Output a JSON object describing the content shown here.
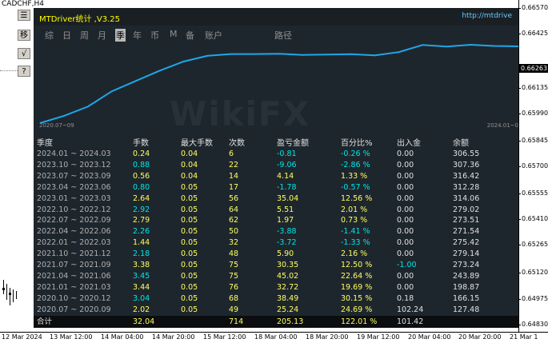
{
  "symbol": "CADCHF,H4",
  "price_axis": {
    "current": "0.66263",
    "ticks": [
      "0.66570",
      "0.66425",
      "0.66135",
      "0.65990",
      "0.65845",
      "0.65700",
      "0.65555",
      "0.65410",
      "0.65265",
      "0.65120",
      "0.64975",
      "0.64830"
    ]
  },
  "time_axis": [
    "12 Mar 2024",
    "13 Mar 12:00",
    "14 Mar 04:00",
    "14 Mar 20:00",
    "15 Mar 12:00",
    "18 Mar 04:00",
    "18 Mar 20:00",
    "19 Mar 12:00",
    "20 Mar 04:00",
    "20 Mar 20:00",
    "21 Mar 1"
  ],
  "tools": [
    "☰",
    "移",
    "√",
    "?"
  ],
  "panel": {
    "title": "MTDriver统计 ,V3.25",
    "url": "http://mtdrive",
    "tabs": [
      "综",
      "日",
      "周",
      "月",
      "季",
      "年",
      "币",
      "M",
      "备",
      "账户",
      "路径"
    ],
    "active_tab": "季",
    "curve_start_label": "2020.07~09",
    "curve_end_label": "2024.01~0",
    "curve_values": [
      0.0,
      4.14,
      9.4,
      18.2,
      24.1,
      30.0,
      35.2,
      38.5,
      39.5,
      39.5,
      39.7,
      39.0,
      39.2,
      39.4,
      38.7,
      40.6,
      44.7,
      43.8,
      44.8,
      44.1,
      43.9
    ],
    "curve_color": "#1ea7e8",
    "headers": [
      "季度",
      "手数",
      "最大手数",
      "次数",
      "盈亏金额",
      "百分比%",
      "出入金",
      "余额"
    ],
    "rows": [
      [
        "2024.01 ~ 2024.03",
        "0.24",
        "0.04",
        "6",
        "-0.81",
        "-0.26 %",
        "0.00",
        "306.55"
      ],
      [
        "2023.10 ~ 2023.12",
        "0.88",
        "0.04",
        "22",
        "-9.06",
        "-2.86 %",
        "0.00",
        "307.36"
      ],
      [
        "2023.07 ~ 2023.09",
        "0.56",
        "0.04",
        "14",
        "4.14",
        "1.33 %",
        "0.00",
        "316.42"
      ],
      [
        "2023.04 ~ 2023.06",
        "0.80",
        "0.05",
        "17",
        "-1.78",
        "-0.57 %",
        "0.00",
        "312.28"
      ],
      [
        "2023.01 ~ 2023.03",
        "2.64",
        "0.05",
        "56",
        "35.04",
        "12.56 %",
        "0.00",
        "314.06"
      ],
      [
        "2022.10 ~ 2022.12",
        "2.92",
        "0.05",
        "64",
        "5.51",
        "2.01 %",
        "0.00",
        "279.02"
      ],
      [
        "2022.07 ~ 2022.09",
        "2.79",
        "0.05",
        "62",
        "1.97",
        "0.73 %",
        "0.00",
        "273.51"
      ],
      [
        "2022.04 ~ 2022.06",
        "2.26",
        "0.05",
        "50",
        "-3.88",
        "-1.41 %",
        "0.00",
        "271.54"
      ],
      [
        "2022.01 ~ 2022.03",
        "1.44",
        "0.05",
        "32",
        "-3.72",
        "-1.33 %",
        "0.00",
        "275.42"
      ],
      [
        "2021.10 ~ 2021.12",
        "2.18",
        "0.05",
        "48",
        "5.90",
        "2.16 %",
        "0.00",
        "279.14"
      ],
      [
        "2021.07 ~ 2021.09",
        "3.38",
        "0.05",
        "75",
        "30.35",
        "12.50 %",
        "-1.00",
        "273.24"
      ],
      [
        "2021.04 ~ 2021.06",
        "3.45",
        "0.05",
        "75",
        "45.02",
        "22.64 %",
        "0.00",
        "243.89"
      ],
      [
        "2021.01 ~ 2021.03",
        "3.44",
        "0.05",
        "76",
        "32.72",
        "19.69 %",
        "0.00",
        "198.87"
      ],
      [
        "2020.10 ~ 2020.12",
        "3.04",
        "0.05",
        "68",
        "38.49",
        "30.15 %",
        "0.18",
        "166.15"
      ],
      [
        "2020.07 ~ 2020.09",
        "2.02",
        "0.05",
        "49",
        "25.24",
        "24.69 %",
        "102.24",
        "127.48"
      ]
    ],
    "total": [
      "合计",
      "32.04",
      "",
      "714",
      "205.13",
      "122.01 %",
      "101.42",
      ""
    ]
  }
}
